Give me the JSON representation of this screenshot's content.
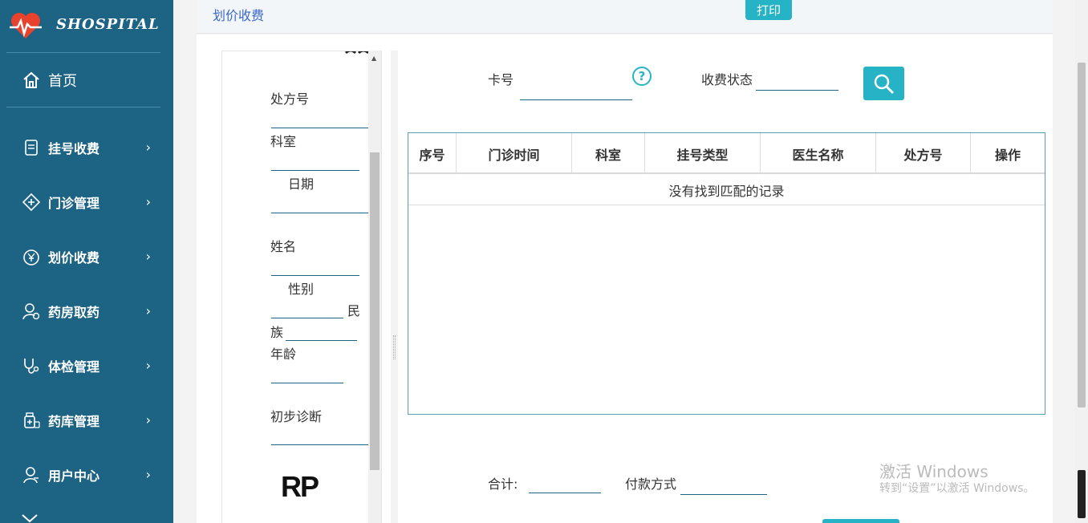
{
  "app": {
    "brand": "SHOSPITAL"
  },
  "sidebar": {
    "home": "首页",
    "items": [
      {
        "label": "挂号收费",
        "icon": "register-icon"
      },
      {
        "label": "门诊管理",
        "icon": "clinic-icon"
      },
      {
        "label": "划价收费",
        "icon": "yuan-icon"
      },
      {
        "label": "药房取药",
        "icon": "pharmacy-user-icon"
      },
      {
        "label": "体检管理",
        "icon": "stethoscope-icon"
      },
      {
        "label": "药库管理",
        "icon": "medicine-store-icon"
      },
      {
        "label": "用户中心",
        "icon": "user-icon"
      }
    ]
  },
  "header": {
    "title": "划价收费",
    "print_label": "打印"
  },
  "form": {
    "prescription_no": "处方号",
    "department": "科室",
    "date": "日期",
    "name": "姓名",
    "gender": "性别",
    "ethnic_part1": "民",
    "ethnic_part2": "族",
    "age": "年龄",
    "diagnosis": "初步诊断",
    "rp": "RP"
  },
  "search": {
    "card_label": "卡号",
    "card_value": "",
    "help": "?",
    "status_label": "收费状态",
    "status_value": ""
  },
  "table": {
    "columns": [
      "序号",
      "门诊时间",
      "科室",
      "挂号类型",
      "医生名称",
      "处方号",
      "操作"
    ],
    "empty_text": "没有找到匹配的记录"
  },
  "footer": {
    "total_label": "合计:",
    "payment_label": "付款方式"
  },
  "watermark": {
    "line1": "激活 Windows",
    "line2": "转到“设置”以激活 Windows。"
  }
}
